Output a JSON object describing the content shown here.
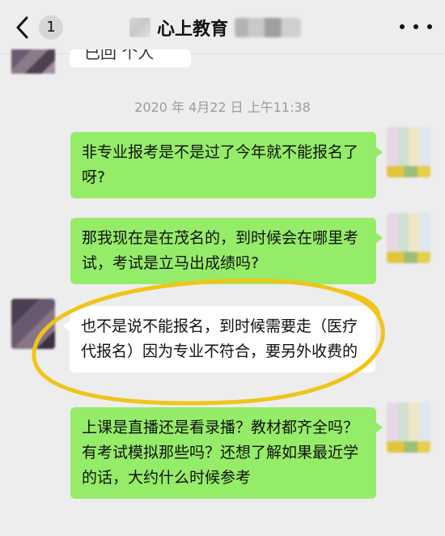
{
  "header": {
    "unread_count": "1",
    "title": "心上教育",
    "icons": {
      "back": "chevron-left-icon",
      "more": "more-dots-icon"
    }
  },
  "chat": {
    "partial_prev_text": "已回 个人",
    "timestamp": "2020 年 4月22 日 上午11:38",
    "messages": [
      {
        "side": "out",
        "text": "非专业报考是不是过了今年就不能报名了呀?"
      },
      {
        "side": "out",
        "text": "那我现在是在茂名的，到时候会在哪里考试，考试是立马出成绩吗?"
      },
      {
        "side": "in",
        "text": "也不是说不能报名，到时候需要走（医疗代报名）因为专业不符合，要另外收费的"
      },
      {
        "side": "out",
        "text": "上课是直播还是看录播？教材都齐全吗？有考试模拟那些吗？还想了解如果最近学的话，大约什么时候参考"
      }
    ]
  },
  "colors": {
    "outgoing_bubble": "#95ec69",
    "incoming_bubble": "#ffffff",
    "background": "#ededed",
    "highlight": "#f0c419"
  }
}
